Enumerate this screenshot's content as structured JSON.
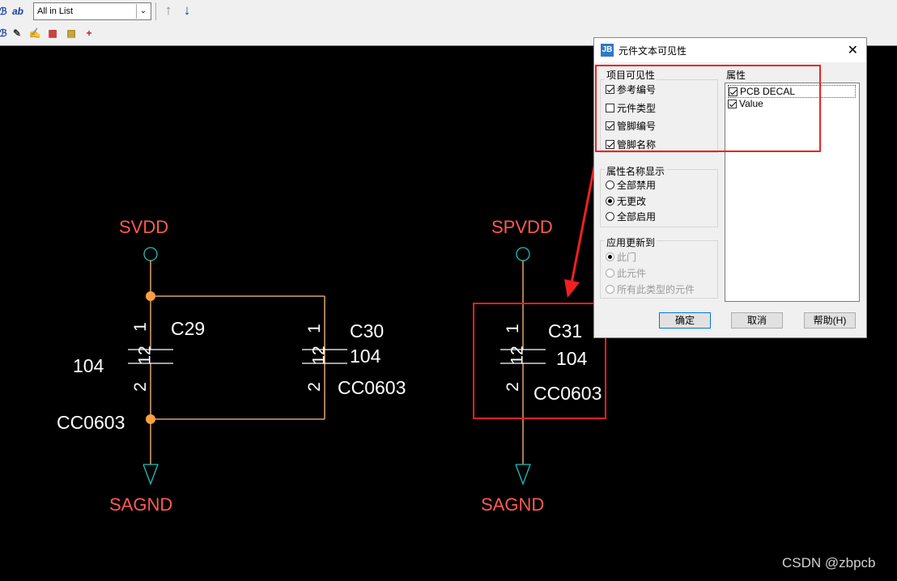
{
  "toolbar": {
    "combo_value": "All in List",
    "combo_arrow": "⌄",
    "up_icon": "↑",
    "down_icon": "↓",
    "ab_label": "ab"
  },
  "schematic": {
    "nets": {
      "svdd": "SVDD",
      "spvdd": "SPVDD",
      "sagnd_left": "SAGND",
      "sagnd_right": "SAGND"
    },
    "c29": {
      "ref": "C29",
      "value": "104",
      "decal": "CC0603",
      "pin1": "1",
      "pin12": "12",
      "pin2": "2"
    },
    "c30": {
      "ref": "C30",
      "value": "104",
      "decal": "CC0603",
      "pin1": "1",
      "pin12": "12",
      "pin2": "2"
    },
    "c31": {
      "ref": "C31",
      "value": "104",
      "decal": "CC0603",
      "pin1": "1",
      "pin12": "12",
      "pin2": "2"
    },
    "colors": {
      "net_label": "#ff5a52",
      "wire": "#ffc080",
      "junction": "#ffa040",
      "power": "#20c0c0",
      "highlight": "#f02020"
    }
  },
  "dialog": {
    "title": "元件文本可见性",
    "close": "✕",
    "item_visibility": {
      "label": "项目可见性",
      "items": [
        {
          "label": "参考编号",
          "checked": true
        },
        {
          "label": "元件类型",
          "checked": false
        },
        {
          "label": "管脚编号",
          "checked": true
        },
        {
          "label": "管脚名称",
          "checked": true
        }
      ]
    },
    "attributes": {
      "label": "属性",
      "items": [
        {
          "label": "PCB DECAL",
          "checked": true
        },
        {
          "label": "Value",
          "checked": true
        }
      ]
    },
    "attr_name_display": {
      "label": "属性名称显示",
      "options": [
        {
          "label": "全部禁用",
          "selected": false
        },
        {
          "label": "无更改",
          "selected": true
        },
        {
          "label": "全部启用",
          "selected": false
        }
      ]
    },
    "apply_to": {
      "label": "应用更新到",
      "options": [
        {
          "label": "此门",
          "selected": true
        },
        {
          "label": "此元件",
          "selected": false
        },
        {
          "label": "所有此类型的元件",
          "selected": false
        }
      ]
    },
    "buttons": {
      "ok": "确定",
      "cancel": "取消",
      "help": "帮助(H)"
    }
  },
  "watermark": "CSDN @zbpcb"
}
